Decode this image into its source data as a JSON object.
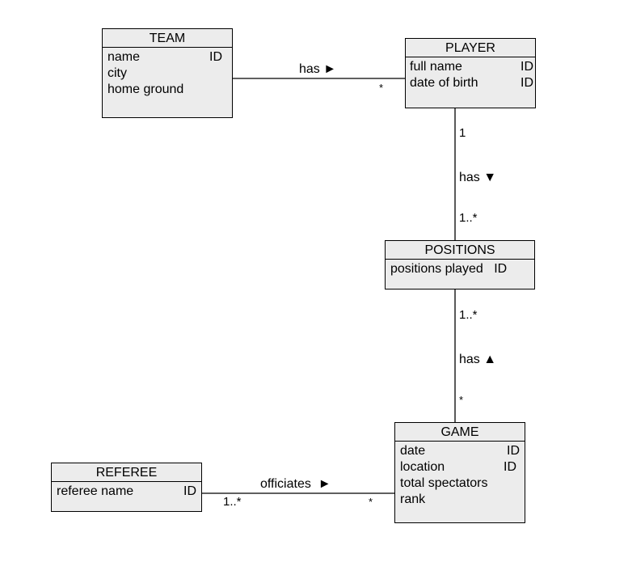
{
  "entities": {
    "team": {
      "name": "TEAM",
      "attributes": [
        {
          "name": "name",
          "key": "ID"
        },
        {
          "name": "city",
          "key": ""
        },
        {
          "name": "home ground",
          "key": ""
        }
      ]
    },
    "player": {
      "name": "PLAYER",
      "attributes": [
        {
          "name": "full name",
          "key": "ID"
        },
        {
          "name": "date of birth",
          "key": "ID"
        }
      ]
    },
    "positions": {
      "name": "POSITIONS",
      "attributes": [
        {
          "name": "positions played",
          "key": "ID"
        }
      ]
    },
    "game": {
      "name": "GAME",
      "attributes": [
        {
          "name": "date",
          "key": "ID"
        },
        {
          "name": "location",
          "key": "ID"
        },
        {
          "name": "total spectators",
          "key": ""
        },
        {
          "name": "rank",
          "key": ""
        }
      ]
    },
    "referee": {
      "name": "REFEREE",
      "attributes": [
        {
          "name": "referee name",
          "key": "ID"
        }
      ]
    }
  },
  "relationships": {
    "team_player": {
      "label": "has ►",
      "from": "TEAM",
      "to": "PLAYER",
      "from_mult": "",
      "to_mult": "*"
    },
    "player_positions": {
      "label": "has ▼",
      "from": "PLAYER",
      "to": "POSITIONS",
      "from_mult": "1",
      "to_mult": "1..*"
    },
    "positions_game": {
      "label": "has ▲",
      "from": "POSITIONS",
      "to": "GAME",
      "from_mult": "1..*",
      "to_mult": "*"
    },
    "referee_game": {
      "label": "officiates  ►",
      "from": "REFEREE",
      "to": "GAME",
      "from_mult": "1..*",
      "to_mult": "*"
    }
  }
}
